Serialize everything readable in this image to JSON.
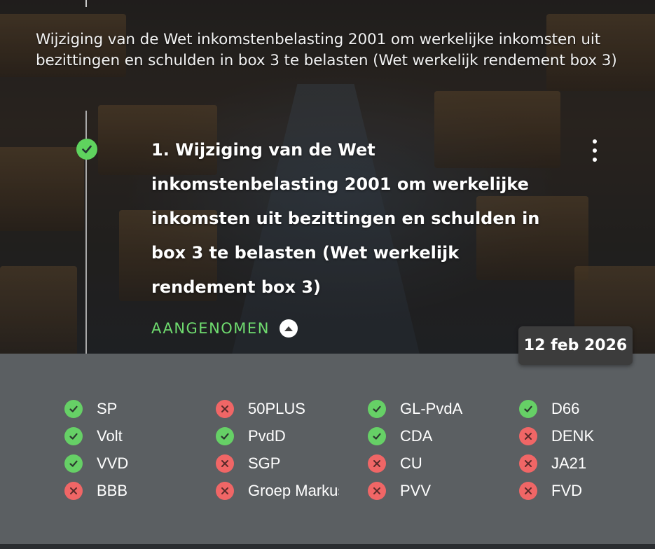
{
  "intro_text": "Wijziging van de Wet inkomstenbelasting 2001 om werkelijke inkomsten uit bezittingen en schulden in box 3 te belasten (Wet werkelijk rendement box 3)",
  "item": {
    "title": "1. Wijziging van de Wet inkomstenbelasting 2001 om werkelijke inkomsten uit bezittingen en schulden in box 3 te belasten (Wet werkelijk rendement box 3)",
    "status": "AANGENOMEN",
    "date": "12 feb 2026"
  },
  "icons": {
    "check": "check-icon",
    "cross": "x-icon",
    "menu": "more-vertical-icon",
    "collapse": "chevron-up-icon"
  },
  "colors": {
    "yes": "#66d066",
    "no": "#f06666",
    "status": "#6fdc6f",
    "panel": "#5b5f62"
  },
  "votes": [
    {
      "party": "SP",
      "vote": "yes"
    },
    {
      "party": "50PLUS",
      "vote": "no"
    },
    {
      "party": "GL-PvdA",
      "vote": "yes"
    },
    {
      "party": "D66",
      "vote": "yes"
    },
    {
      "party": "Volt",
      "vote": "yes"
    },
    {
      "party": "PvdD",
      "vote": "yes"
    },
    {
      "party": "CDA",
      "vote": "yes"
    },
    {
      "party": "DENK",
      "vote": "no"
    },
    {
      "party": "VVD",
      "vote": "yes"
    },
    {
      "party": "SGP",
      "vote": "no"
    },
    {
      "party": "CU",
      "vote": "no"
    },
    {
      "party": "JA21",
      "vote": "no"
    },
    {
      "party": "BBB",
      "vote": "no"
    },
    {
      "party": "Groep Markuszower",
      "vote": "no"
    },
    {
      "party": "PVV",
      "vote": "no"
    },
    {
      "party": "FVD",
      "vote": "no"
    }
  ]
}
